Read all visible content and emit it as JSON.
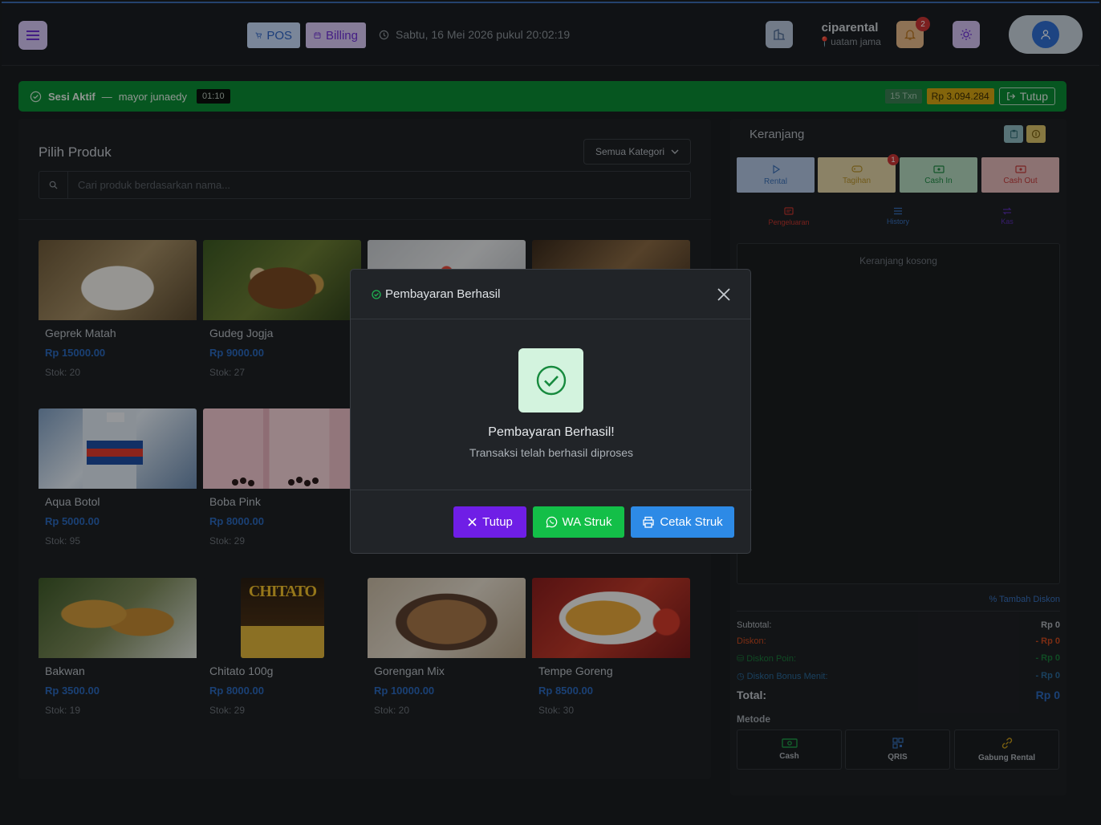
{
  "header": {
    "pos_label": "POS",
    "billing_label": "Billing",
    "datetime": "Sabtu, 16 Mei 2026 pukul 20:02:19",
    "company_name": "ciparental",
    "company_location": "uatam jama",
    "notification_count": "2"
  },
  "session": {
    "label": "Sesi Aktif",
    "separator": "—",
    "operator": "mayor junaedy",
    "timer": "01:10",
    "txn": "15 Txn",
    "amount": "Rp 3.094.284",
    "close_label": "Tutup"
  },
  "products": {
    "title": "Pilih Produk",
    "category_select": "Semua Kategori",
    "search_placeholder": "Cari produk berdasarkan nama...",
    "items": [
      {
        "name": "Geprek Matah",
        "price": "Rp 15000.00",
        "stock": "Stok: 20"
      },
      {
        "name": "Gudeg Jogja",
        "price": "Rp 9000.00",
        "stock": "Stok: 27"
      },
      {
        "name": "",
        "price": "",
        "stock": ""
      },
      {
        "name": "",
        "price": "",
        "stock": ""
      },
      {
        "name": "Aqua Botol",
        "price": "Rp 5000.00",
        "stock": "Stok: 95"
      },
      {
        "name": "Boba Pink",
        "price": "Rp 8000.00",
        "stock": "Stok: 29"
      },
      {
        "name": "Bakwan",
        "price": "Rp 3500.00",
        "stock": "Stok: 19"
      },
      {
        "name": "Chitato 100g",
        "price": "Rp 8000.00",
        "stock": "Stok: 29"
      },
      {
        "name": "Gorengan Mix",
        "price": "Rp 10000.00",
        "stock": "Stok: 20"
      },
      {
        "name": "Tempe Goreng",
        "price": "Rp 8500.00",
        "stock": "Stok: 30"
      }
    ],
    "chitato_logo_text": "CHITATO"
  },
  "cart": {
    "title": "Keranjang",
    "actions": {
      "rental": "Rental",
      "tagihan": "Tagihan",
      "tagihan_badge": "1",
      "cash_in": "Cash In",
      "cash_out": "Cash Out",
      "pengeluaran": "Pengeluaran",
      "history": "History",
      "kas": "Kas"
    },
    "empty_text": "Keranjang kosong",
    "add_discount": "Tambah Diskon",
    "subtotal_label": "Subtotal:",
    "subtotal_value": "Rp 0",
    "diskon_label": "Diskon:",
    "diskon_value": "- Rp 0",
    "diskon_poin_label": "Diskon Poin:",
    "diskon_poin_value": "- Rp 0",
    "diskon_bonus_label": "Diskon Bonus Menit:",
    "diskon_bonus_value": "- Rp 0",
    "total_label": "Total:",
    "total_value": "Rp 0",
    "metode_label": "Metode",
    "methods": {
      "cash": "Cash",
      "qris": "QRIS",
      "gabung": "Gabung Rental"
    }
  },
  "modal": {
    "header_title": "Pembayaran Berhasil",
    "title": "Pembayaran Berhasil!",
    "subtitle": "Transaksi telah berhasil diproses",
    "btn_close": "Tutup",
    "btn_wa": "WA Struk",
    "btn_print": "Cetak Struk"
  },
  "colors": {
    "session_green": "#0a8b34",
    "price_blue": "#2a68bc",
    "modal_purple": "#6f1ee6",
    "wa_green": "#13bf48",
    "print_blue": "#2d8ae6"
  }
}
